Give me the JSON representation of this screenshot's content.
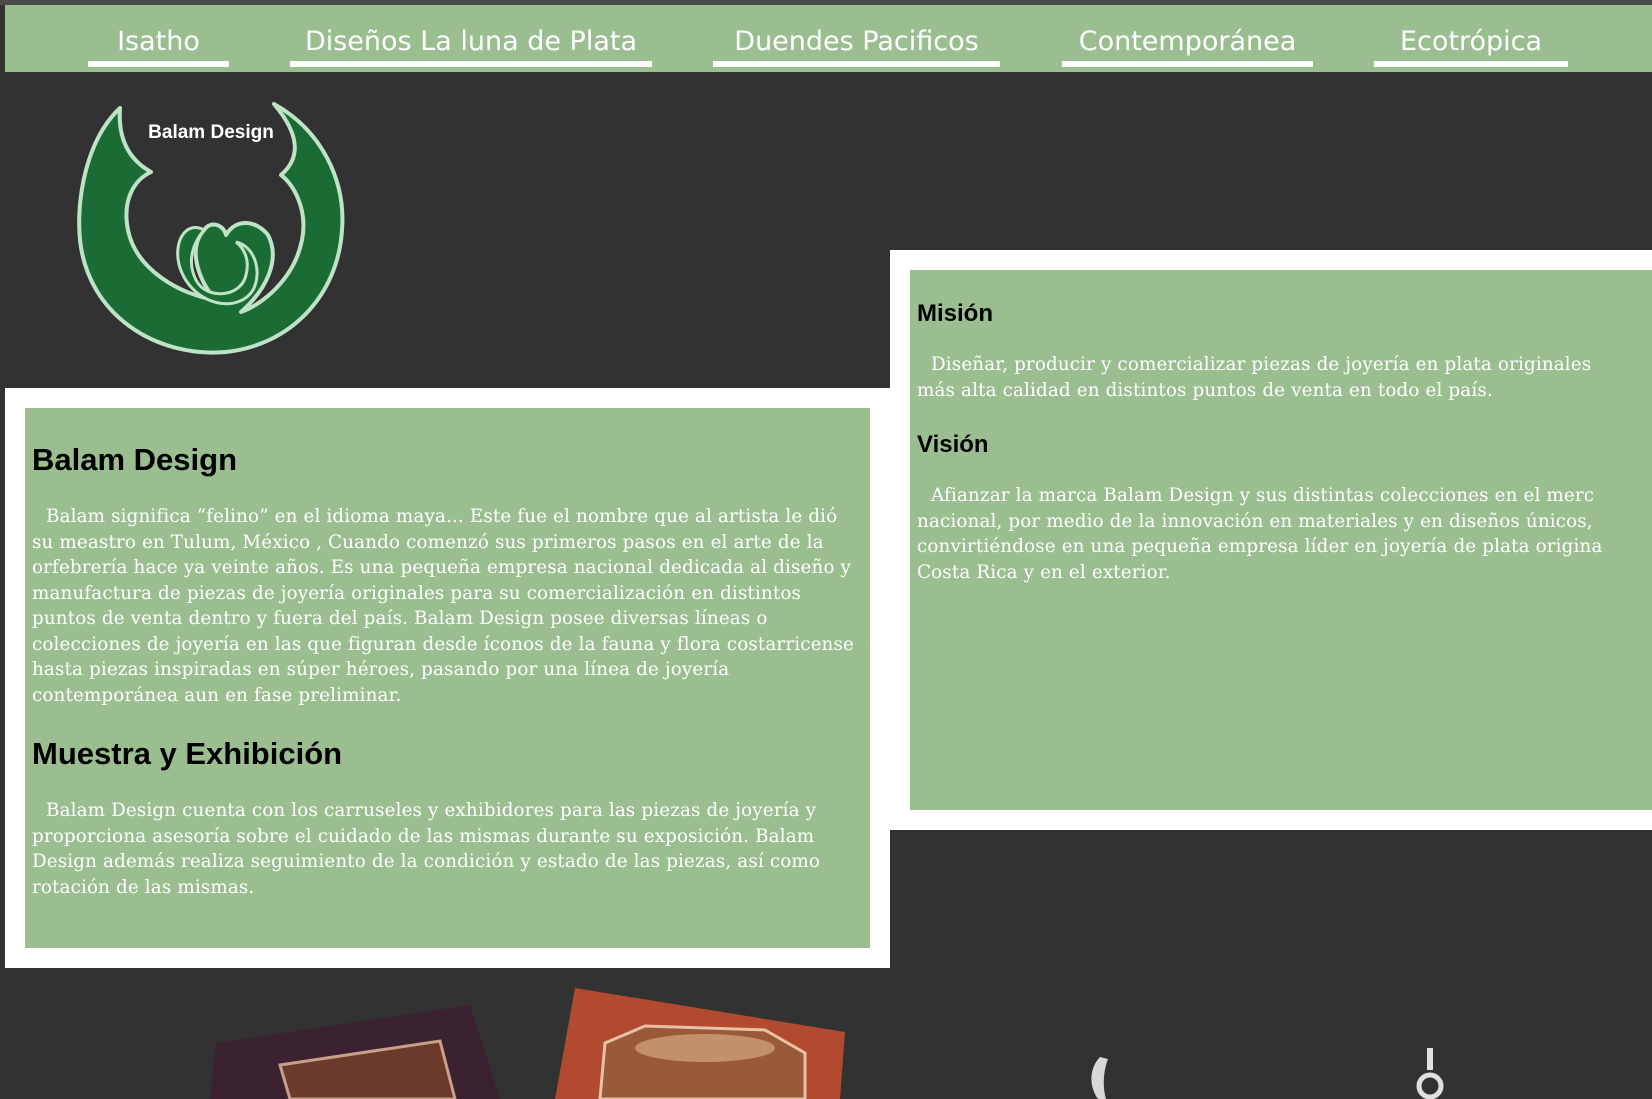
{
  "nav": {
    "items": [
      "Isatho",
      "Diseños La luna de Plata",
      "Duendes Pacificos",
      "Contemporánea",
      "Ecotrópica"
    ]
  },
  "logo": {
    "text": "Balam Design",
    "icon": "jaguar-crescent-logo-icon",
    "color": "#1b6b35"
  },
  "about": {
    "title": "Balam Design",
    "body": "Balam significa “felino” en el idioma maya... Este fue el nombre que al artista le dió su meastro en Tulum, México , Cuando comenzó sus primeros pasos en el arte de la orfebrería hace ya veinte años. Es una pequeña empresa nacional dedicada al diseño y manufactura de piezas de joyería originales para su comercialización en distintos puntos de venta dentro y fuera del país. Balam Design posee diversas líneas o colecciones de joyería en las que figuran desde íconos de la fauna y flora costarricense hasta piezas inspiradas en súper héroes, pasando por una línea de joyería contemporánea aun en fase preliminar.",
    "section2_title": "Muestra y Exhibición",
    "section2_body": "Balam Design cuenta con los carruseles y exhibidores para las piezas de joyería y proporciona asesoría sobre el cuidado de las mismas durante su exposición. Balam Design además realiza seguimiento de la condición y estado de las piezas, así como rotación de las mismas."
  },
  "mission": {
    "title": "Misión",
    "lines": [
      "Diseñar, producir y comercializar piezas de joyería en plata originales",
      "más alta calidad en distintos puntos de venta en todo el país."
    ]
  },
  "vision": {
    "title": "Visión",
    "lines": [
      "Afianzar la marca Balam Design y sus distintas colecciones en el merc",
      "nacional, por medio de la innovación en materiales y en diseños únicos,",
      "convirtiéndose en una pequeña empresa líder en joyería de plata origina",
      "Costa Rica y en el exterior."
    ]
  },
  "colors": {
    "page_bg": "#323232",
    "green": "#9bbe91",
    "logo_green": "#1b6b35",
    "white": "#ffffff"
  }
}
